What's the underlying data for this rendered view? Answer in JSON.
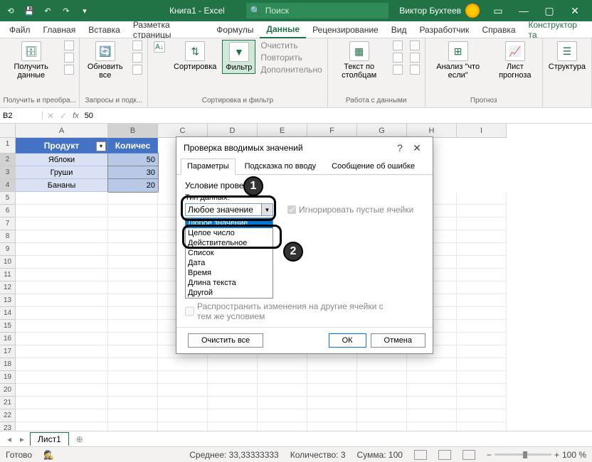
{
  "titlebar": {
    "book": "Книга1 - Excel",
    "search_placeholder": "Поиск",
    "user": "Виктор Бухтеев"
  },
  "menu": {
    "file": "Файл",
    "home": "Главная",
    "insert": "Вставка",
    "page": "Разметка страницы",
    "formula": "Формулы",
    "data": "Данные",
    "review": "Рецензирование",
    "view": "Вид",
    "dev": "Разработчик",
    "help": "Справка",
    "designer": "Конструктор та"
  },
  "ribbon": {
    "getdata": "Получить\nданные",
    "group1": "Получить и преобра...",
    "refresh": "Обновить\nвсе",
    "group2": "Запросы и подк...",
    "sort": "Сортировка",
    "filter": "Фильтр",
    "clear": "Очистить",
    "reapply": "Повторить",
    "advanced": "Дополнительно",
    "group3": "Сортировка и фильтр",
    "texttocol": "Текст по\nстолбцам",
    "group4": "Работа с данными",
    "whatif": "Анализ \"что\nесли\"",
    "forecast": "Лист\nпрогноза",
    "group5": "Прогноз",
    "structure": "Структура"
  },
  "formulabar": {
    "namebox": "B2",
    "fx": "fx",
    "value": "50"
  },
  "cols": [
    "A",
    "B",
    "C",
    "D",
    "E",
    "F",
    "G",
    "H",
    "I"
  ],
  "table": {
    "h1": "Продукт",
    "h2": "Количес",
    "r1": {
      "a": "Яблоки",
      "b": "50"
    },
    "r2": {
      "a": "Груши",
      "b": "30"
    },
    "r3": {
      "a": "Бананы",
      "b": "20"
    }
  },
  "sheet": {
    "name": "Лист1"
  },
  "status": {
    "ready": "Готово",
    "avg": "Среднее: 33,33333333",
    "count": "Количество: 3",
    "sum": "Сумма: 100",
    "zoom": "100 %"
  },
  "dialog": {
    "title": "Проверка вводимых значений",
    "tab1": "Параметры",
    "tab2": "Подсказка по вводу",
    "tab3": "Сообщение об ошибке",
    "section": "Условие проверки",
    "type_label": "Тип данных:",
    "selected": "Любое значение",
    "opts": {
      "any": "Любое значение",
      "int": "Целое число",
      "real": "Действительное",
      "list": "Список",
      "date": "Дата",
      "time": "Время",
      "len": "Длина текста",
      "other": "Другой"
    },
    "ignore": "Игнорировать пустые ячейки",
    "spread": "Распространить изменения на другие ячейки с тем же условием",
    "clear": "Очистить все",
    "ok": "ОК",
    "cancel": "Отмена"
  }
}
